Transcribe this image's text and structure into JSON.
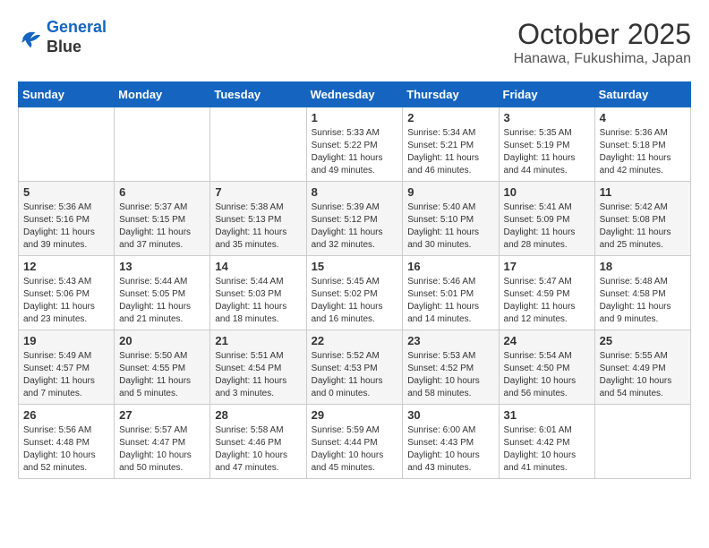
{
  "header": {
    "logo_line1": "General",
    "logo_line2": "Blue",
    "month_title": "October 2025",
    "location": "Hanawa, Fukushima, Japan"
  },
  "days_of_week": [
    "Sunday",
    "Monday",
    "Tuesday",
    "Wednesday",
    "Thursday",
    "Friday",
    "Saturday"
  ],
  "weeks": [
    [
      {
        "day": "",
        "info": ""
      },
      {
        "day": "",
        "info": ""
      },
      {
        "day": "",
        "info": ""
      },
      {
        "day": "1",
        "info": "Sunrise: 5:33 AM\nSunset: 5:22 PM\nDaylight: 11 hours\nand 49 minutes."
      },
      {
        "day": "2",
        "info": "Sunrise: 5:34 AM\nSunset: 5:21 PM\nDaylight: 11 hours\nand 46 minutes."
      },
      {
        "day": "3",
        "info": "Sunrise: 5:35 AM\nSunset: 5:19 PM\nDaylight: 11 hours\nand 44 minutes."
      },
      {
        "day": "4",
        "info": "Sunrise: 5:36 AM\nSunset: 5:18 PM\nDaylight: 11 hours\nand 42 minutes."
      }
    ],
    [
      {
        "day": "5",
        "info": "Sunrise: 5:36 AM\nSunset: 5:16 PM\nDaylight: 11 hours\nand 39 minutes."
      },
      {
        "day": "6",
        "info": "Sunrise: 5:37 AM\nSunset: 5:15 PM\nDaylight: 11 hours\nand 37 minutes."
      },
      {
        "day": "7",
        "info": "Sunrise: 5:38 AM\nSunset: 5:13 PM\nDaylight: 11 hours\nand 35 minutes."
      },
      {
        "day": "8",
        "info": "Sunrise: 5:39 AM\nSunset: 5:12 PM\nDaylight: 11 hours\nand 32 minutes."
      },
      {
        "day": "9",
        "info": "Sunrise: 5:40 AM\nSunset: 5:10 PM\nDaylight: 11 hours\nand 30 minutes."
      },
      {
        "day": "10",
        "info": "Sunrise: 5:41 AM\nSunset: 5:09 PM\nDaylight: 11 hours\nand 28 minutes."
      },
      {
        "day": "11",
        "info": "Sunrise: 5:42 AM\nSunset: 5:08 PM\nDaylight: 11 hours\nand 25 minutes."
      }
    ],
    [
      {
        "day": "12",
        "info": "Sunrise: 5:43 AM\nSunset: 5:06 PM\nDaylight: 11 hours\nand 23 minutes."
      },
      {
        "day": "13",
        "info": "Sunrise: 5:44 AM\nSunset: 5:05 PM\nDaylight: 11 hours\nand 21 minutes."
      },
      {
        "day": "14",
        "info": "Sunrise: 5:44 AM\nSunset: 5:03 PM\nDaylight: 11 hours\nand 18 minutes."
      },
      {
        "day": "15",
        "info": "Sunrise: 5:45 AM\nSunset: 5:02 PM\nDaylight: 11 hours\nand 16 minutes."
      },
      {
        "day": "16",
        "info": "Sunrise: 5:46 AM\nSunset: 5:01 PM\nDaylight: 11 hours\nand 14 minutes."
      },
      {
        "day": "17",
        "info": "Sunrise: 5:47 AM\nSunset: 4:59 PM\nDaylight: 11 hours\nand 12 minutes."
      },
      {
        "day": "18",
        "info": "Sunrise: 5:48 AM\nSunset: 4:58 PM\nDaylight: 11 hours\nand 9 minutes."
      }
    ],
    [
      {
        "day": "19",
        "info": "Sunrise: 5:49 AM\nSunset: 4:57 PM\nDaylight: 11 hours\nand 7 minutes."
      },
      {
        "day": "20",
        "info": "Sunrise: 5:50 AM\nSunset: 4:55 PM\nDaylight: 11 hours\nand 5 minutes."
      },
      {
        "day": "21",
        "info": "Sunrise: 5:51 AM\nSunset: 4:54 PM\nDaylight: 11 hours\nand 3 minutes."
      },
      {
        "day": "22",
        "info": "Sunrise: 5:52 AM\nSunset: 4:53 PM\nDaylight: 11 hours\nand 0 minutes."
      },
      {
        "day": "23",
        "info": "Sunrise: 5:53 AM\nSunset: 4:52 PM\nDaylight: 10 hours\nand 58 minutes."
      },
      {
        "day": "24",
        "info": "Sunrise: 5:54 AM\nSunset: 4:50 PM\nDaylight: 10 hours\nand 56 minutes."
      },
      {
        "day": "25",
        "info": "Sunrise: 5:55 AM\nSunset: 4:49 PM\nDaylight: 10 hours\nand 54 minutes."
      }
    ],
    [
      {
        "day": "26",
        "info": "Sunrise: 5:56 AM\nSunset: 4:48 PM\nDaylight: 10 hours\nand 52 minutes."
      },
      {
        "day": "27",
        "info": "Sunrise: 5:57 AM\nSunset: 4:47 PM\nDaylight: 10 hours\nand 50 minutes."
      },
      {
        "day": "28",
        "info": "Sunrise: 5:58 AM\nSunset: 4:46 PM\nDaylight: 10 hours\nand 47 minutes."
      },
      {
        "day": "29",
        "info": "Sunrise: 5:59 AM\nSunset: 4:44 PM\nDaylight: 10 hours\nand 45 minutes."
      },
      {
        "day": "30",
        "info": "Sunrise: 6:00 AM\nSunset: 4:43 PM\nDaylight: 10 hours\nand 43 minutes."
      },
      {
        "day": "31",
        "info": "Sunrise: 6:01 AM\nSunset: 4:42 PM\nDaylight: 10 hours\nand 41 minutes."
      },
      {
        "day": "",
        "info": ""
      }
    ]
  ]
}
